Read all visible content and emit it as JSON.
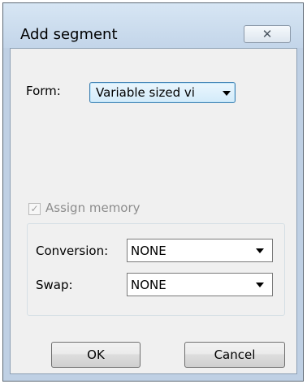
{
  "window": {
    "title": "Add segment",
    "close_glyph": "✕"
  },
  "form": {
    "label": "Form:",
    "selected": "Variable sized vi"
  },
  "assign_memory": {
    "label": "Assign memory",
    "checked": true,
    "disabled": true
  },
  "conversion": {
    "label": "Conversion:",
    "value": "NONE"
  },
  "swap": {
    "label": "Swap:",
    "value": "NONE"
  },
  "buttons": {
    "ok": "OK",
    "cancel": "Cancel"
  },
  "icons": {
    "close": "close-icon",
    "dropdown": "chevron-down-icon",
    "check": "check-icon"
  }
}
